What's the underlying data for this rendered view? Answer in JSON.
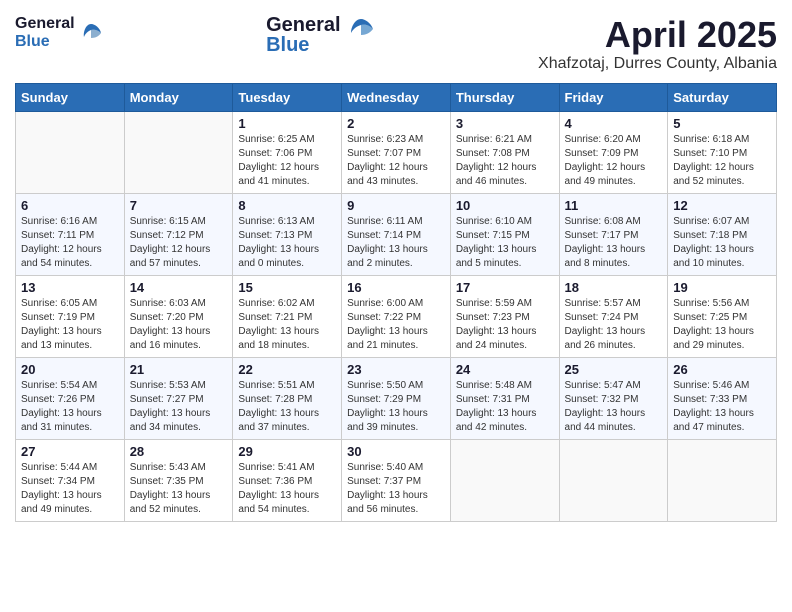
{
  "header": {
    "logo_general": "General",
    "logo_blue": "Blue",
    "title": "April 2025",
    "location": "Xhafzotaj, Durres County, Albania"
  },
  "weekdays": [
    "Sunday",
    "Monday",
    "Tuesday",
    "Wednesday",
    "Thursday",
    "Friday",
    "Saturday"
  ],
  "weeks": [
    [
      {
        "day": "",
        "info": ""
      },
      {
        "day": "",
        "info": ""
      },
      {
        "day": "1",
        "info": "Sunrise: 6:25 AM\nSunset: 7:06 PM\nDaylight: 12 hours and 41 minutes."
      },
      {
        "day": "2",
        "info": "Sunrise: 6:23 AM\nSunset: 7:07 PM\nDaylight: 12 hours and 43 minutes."
      },
      {
        "day": "3",
        "info": "Sunrise: 6:21 AM\nSunset: 7:08 PM\nDaylight: 12 hours and 46 minutes."
      },
      {
        "day": "4",
        "info": "Sunrise: 6:20 AM\nSunset: 7:09 PM\nDaylight: 12 hours and 49 minutes."
      },
      {
        "day": "5",
        "info": "Sunrise: 6:18 AM\nSunset: 7:10 PM\nDaylight: 12 hours and 52 minutes."
      }
    ],
    [
      {
        "day": "6",
        "info": "Sunrise: 6:16 AM\nSunset: 7:11 PM\nDaylight: 12 hours and 54 minutes."
      },
      {
        "day": "7",
        "info": "Sunrise: 6:15 AM\nSunset: 7:12 PM\nDaylight: 12 hours and 57 minutes."
      },
      {
        "day": "8",
        "info": "Sunrise: 6:13 AM\nSunset: 7:13 PM\nDaylight: 13 hours and 0 minutes."
      },
      {
        "day": "9",
        "info": "Sunrise: 6:11 AM\nSunset: 7:14 PM\nDaylight: 13 hours and 2 minutes."
      },
      {
        "day": "10",
        "info": "Sunrise: 6:10 AM\nSunset: 7:15 PM\nDaylight: 13 hours and 5 minutes."
      },
      {
        "day": "11",
        "info": "Sunrise: 6:08 AM\nSunset: 7:17 PM\nDaylight: 13 hours and 8 minutes."
      },
      {
        "day": "12",
        "info": "Sunrise: 6:07 AM\nSunset: 7:18 PM\nDaylight: 13 hours and 10 minutes."
      }
    ],
    [
      {
        "day": "13",
        "info": "Sunrise: 6:05 AM\nSunset: 7:19 PM\nDaylight: 13 hours and 13 minutes."
      },
      {
        "day": "14",
        "info": "Sunrise: 6:03 AM\nSunset: 7:20 PM\nDaylight: 13 hours and 16 minutes."
      },
      {
        "day": "15",
        "info": "Sunrise: 6:02 AM\nSunset: 7:21 PM\nDaylight: 13 hours and 18 minutes."
      },
      {
        "day": "16",
        "info": "Sunrise: 6:00 AM\nSunset: 7:22 PM\nDaylight: 13 hours and 21 minutes."
      },
      {
        "day": "17",
        "info": "Sunrise: 5:59 AM\nSunset: 7:23 PM\nDaylight: 13 hours and 24 minutes."
      },
      {
        "day": "18",
        "info": "Sunrise: 5:57 AM\nSunset: 7:24 PM\nDaylight: 13 hours and 26 minutes."
      },
      {
        "day": "19",
        "info": "Sunrise: 5:56 AM\nSunset: 7:25 PM\nDaylight: 13 hours and 29 minutes."
      }
    ],
    [
      {
        "day": "20",
        "info": "Sunrise: 5:54 AM\nSunset: 7:26 PM\nDaylight: 13 hours and 31 minutes."
      },
      {
        "day": "21",
        "info": "Sunrise: 5:53 AM\nSunset: 7:27 PM\nDaylight: 13 hours and 34 minutes."
      },
      {
        "day": "22",
        "info": "Sunrise: 5:51 AM\nSunset: 7:28 PM\nDaylight: 13 hours and 37 minutes."
      },
      {
        "day": "23",
        "info": "Sunrise: 5:50 AM\nSunset: 7:29 PM\nDaylight: 13 hours and 39 minutes."
      },
      {
        "day": "24",
        "info": "Sunrise: 5:48 AM\nSunset: 7:31 PM\nDaylight: 13 hours and 42 minutes."
      },
      {
        "day": "25",
        "info": "Sunrise: 5:47 AM\nSunset: 7:32 PM\nDaylight: 13 hours and 44 minutes."
      },
      {
        "day": "26",
        "info": "Sunrise: 5:46 AM\nSunset: 7:33 PM\nDaylight: 13 hours and 47 minutes."
      }
    ],
    [
      {
        "day": "27",
        "info": "Sunrise: 5:44 AM\nSunset: 7:34 PM\nDaylight: 13 hours and 49 minutes."
      },
      {
        "day": "28",
        "info": "Sunrise: 5:43 AM\nSunset: 7:35 PM\nDaylight: 13 hours and 52 minutes."
      },
      {
        "day": "29",
        "info": "Sunrise: 5:41 AM\nSunset: 7:36 PM\nDaylight: 13 hours and 54 minutes."
      },
      {
        "day": "30",
        "info": "Sunrise: 5:40 AM\nSunset: 7:37 PM\nDaylight: 13 hours and 56 minutes."
      },
      {
        "day": "",
        "info": ""
      },
      {
        "day": "",
        "info": ""
      },
      {
        "day": "",
        "info": ""
      }
    ]
  ]
}
